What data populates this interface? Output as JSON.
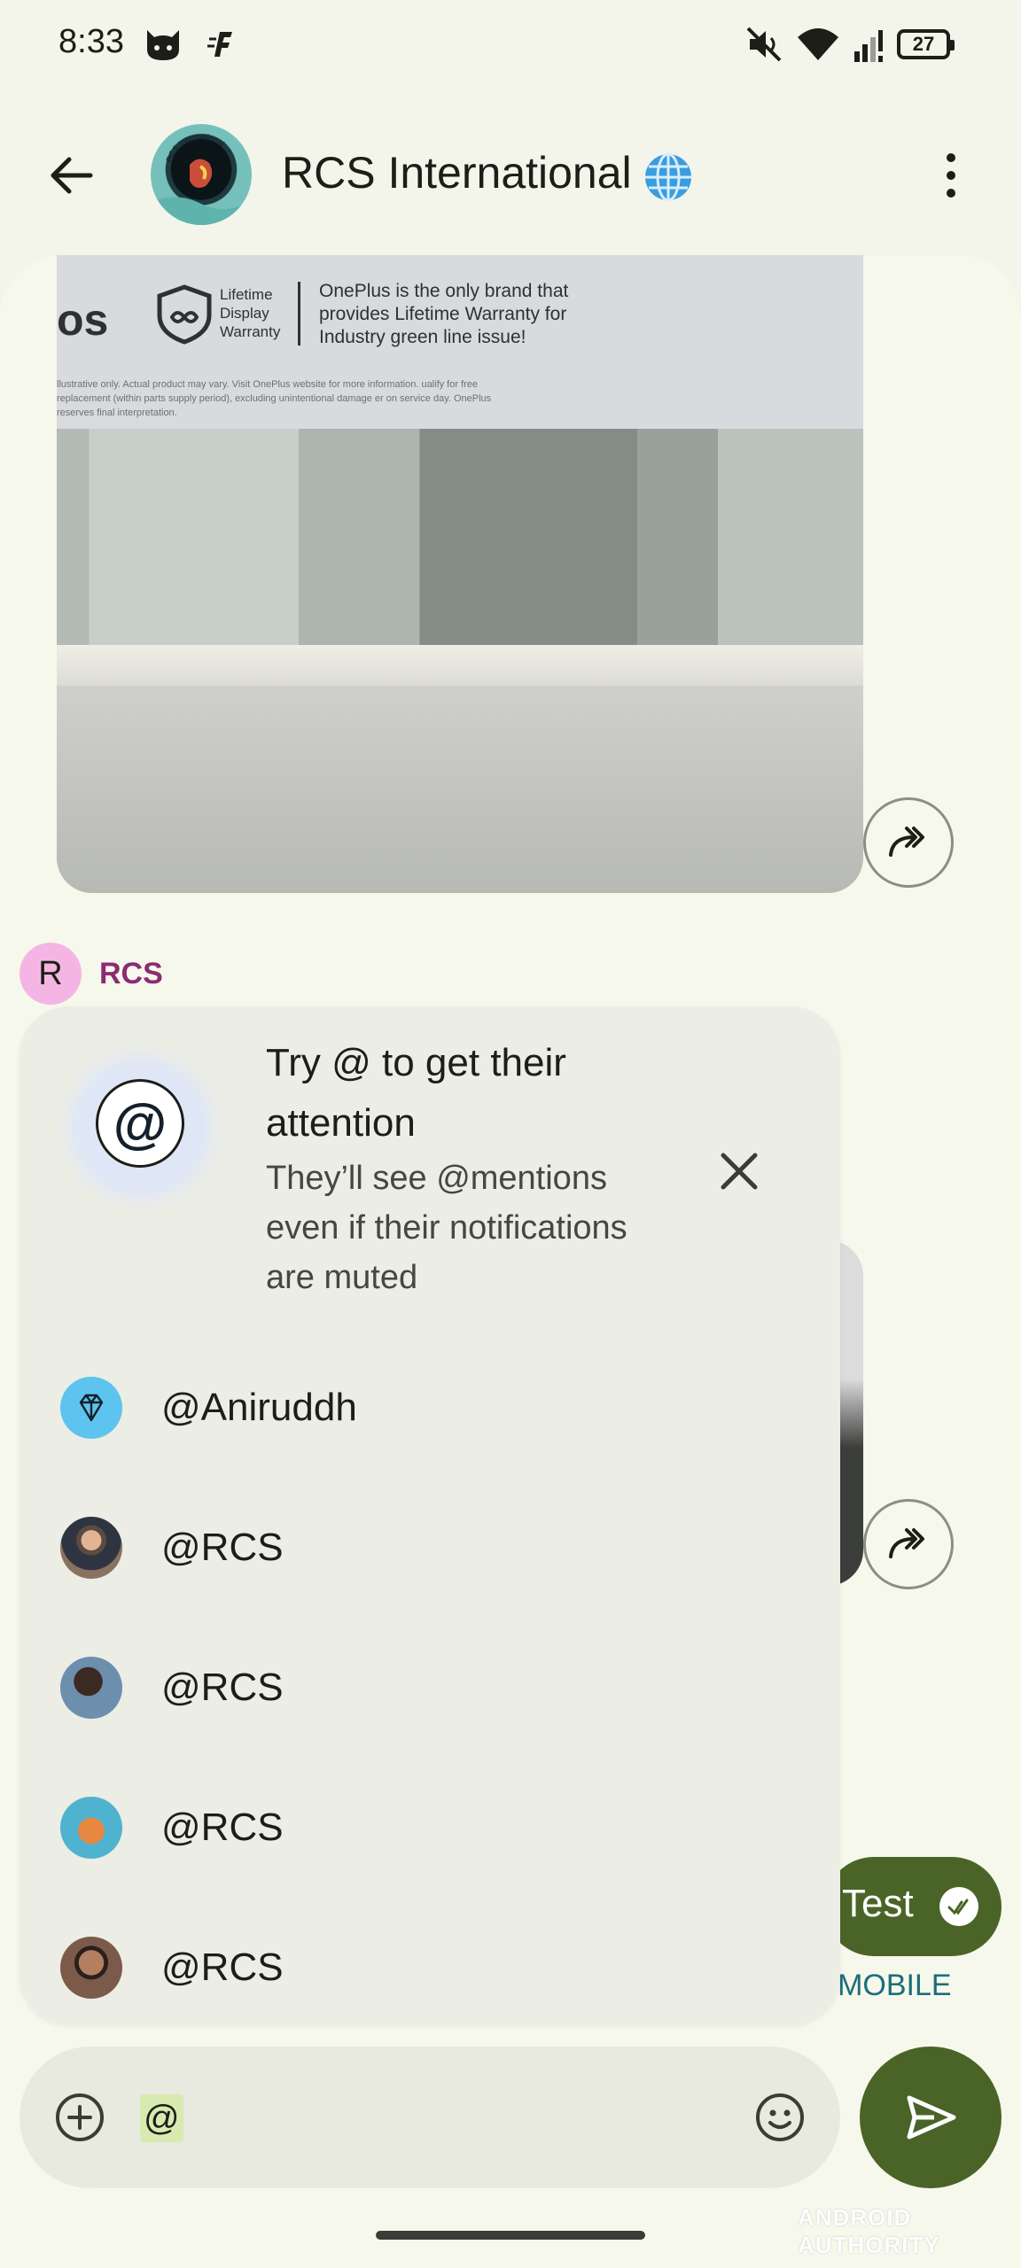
{
  "status_bar": {
    "time": "8:33",
    "battery": "27",
    "icons": [
      "cat-app-icon",
      "f-app-icon",
      "mute-icon",
      "wifi-icon",
      "signal-icon",
      "battery-icon"
    ]
  },
  "app_bar": {
    "title": "RCS International",
    "title_emoji": "🌐",
    "avatar_caption": "RCS International",
    "icons": [
      "back-arrow-icon",
      "globe-icon",
      "more-vert-icon"
    ]
  },
  "photo_message": {
    "brand_fragment": "os",
    "warranty_label": "Lifetime Display Warranty",
    "claim_text": "OnePlus is the only brand that provides Lifetime Warranty for Industry green line issue!",
    "fine_print": "llustrative only. Actual product may vary. Visit OnePlus website for more information. ualify for free replacement (within parts supply period), excluding unintentional damage er on service day. OnePlus reserves final interpretation."
  },
  "sender": {
    "initial": "R",
    "name": "RCS",
    "avatar_color": "#f5b5e4"
  },
  "mention_tip": {
    "title": "Try @ to get their attention",
    "body": "They’ll see @mentions even if their notifications are muted",
    "icon_glyph": "@"
  },
  "mentions": [
    {
      "name": "@Aniruddh",
      "avatar": "diamond-avatar"
    },
    {
      "name": "@RCS",
      "avatar": "photo-avatar"
    },
    {
      "name": "@RCS",
      "avatar": "photo-avatar"
    },
    {
      "name": "@RCS",
      "avatar": "photo-avatar"
    },
    {
      "name": "@RCS",
      "avatar": "photo-avatar"
    }
  ],
  "outgoing_message": {
    "text": "Test",
    "label": "L MOBILE"
  },
  "composer": {
    "value": "@"
  },
  "watermark": "ANDROID AUTHORITY",
  "colors": {
    "background": "#f3f5ea",
    "accent": "#4a6427",
    "sender_name": "#8a2c73",
    "popup": "#ecede4"
  }
}
